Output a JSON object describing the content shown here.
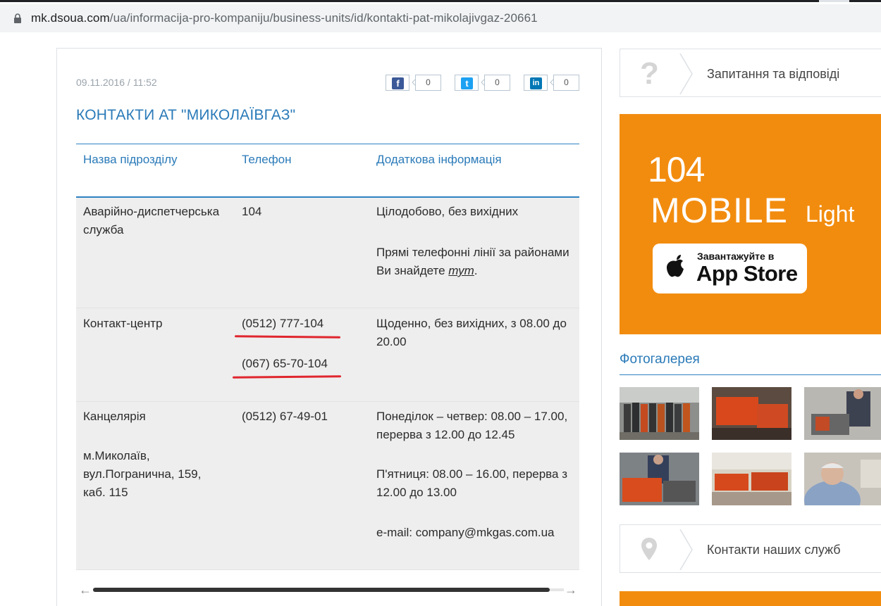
{
  "browser": {
    "url_host": "mk.dsoua.com",
    "url_path": "/ua/informacija-pro-kompaniju/business-units/id/kontakti-pat-mikolajivgaz-20661"
  },
  "article": {
    "date": "09.11.2016 / 11:52",
    "title": "КОНТАКТИ АТ \"МИКОЛАЇВГАЗ\"",
    "share": [
      {
        "network": "facebook",
        "icon": "f",
        "count": "0",
        "color": "#3b5998"
      },
      {
        "network": "twitter",
        "icon": "t",
        "count": "0",
        "color": "#1da1f2"
      },
      {
        "network": "linkedin",
        "icon": "in",
        "count": "0",
        "color": "#0077b5"
      }
    ]
  },
  "table": {
    "headers": [
      "Назва підрозділу",
      "Телефон",
      "Додаткова інформація"
    ],
    "rows": [
      {
        "unit": [
          "Аварійно-диспетчерська",
          "служба"
        ],
        "phones": [
          "104"
        ],
        "info": [
          "Цілодобово, без вихідних",
          "Прямі телефонні лінії за районами",
          "Ви знайдете"
        ],
        "info_link": "тут"
      },
      {
        "unit": [
          "Контакт-центр"
        ],
        "phones": [
          "(0512) 777-104",
          "(067) 65-70-104"
        ],
        "info": [
          "Щоденно, без вихідних, з 08.00 до",
          "20.00"
        ]
      },
      {
        "unit": [
          "Канцелярія",
          "м.Миколаїв,",
          "вул.Погранична, 159,",
          "каб. 115"
        ],
        "phones": [
          "(0512) 67-49-01"
        ],
        "info": [
          "Понеділок – четвер: 08.00 – 17.00,",
          "перерва з 12.00 до 12.45",
          "П'ятниця: 08.00 – 16.00, перерва з",
          "12.00 до 13.00",
          "e-mail: company@mkgas.com.ua"
        ]
      }
    ]
  },
  "sidebar": {
    "qa_label": "Запитання та відповіді",
    "promo": {
      "number": "104",
      "brand": "MOBILE",
      "brand_suffix": "Light",
      "store_small": "Завантажуйте в",
      "store_big": "App Store"
    },
    "gallery_title": "Фотогалерея",
    "contacts_label": "Контакти наших служб"
  },
  "colors": {
    "accent": "#2a7ab8",
    "promo": "#f28c0f",
    "annotation": "#e0262e"
  }
}
